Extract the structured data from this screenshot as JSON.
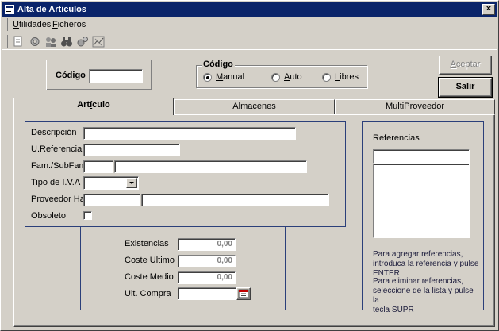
{
  "window": {
    "title": "Alta de Articulos",
    "close_glyph": "×"
  },
  "menu": {
    "items": [
      {
        "label": "Utilidades",
        "accel": "U",
        "rest": "tilidades"
      },
      {
        "label": "Ficheros",
        "accel": "F",
        "rest": "icheros"
      }
    ]
  },
  "toolbar": {
    "icons": [
      "document-icon",
      "gear-icon",
      "people-icon",
      "binoculars-icon",
      "gears-icon",
      "chart-icon"
    ]
  },
  "codigo": {
    "label": "Código",
    "value": ""
  },
  "codigo_mode": {
    "title": "Código",
    "options": [
      {
        "label": "Manual",
        "accel": "M",
        "rest": "anual",
        "selected": true
      },
      {
        "label": "Auto",
        "accel": "A",
        "rest": "uto",
        "selected": false
      },
      {
        "label": "Libres",
        "accel": "L",
        "rest": "ibres",
        "selected": false
      }
    ]
  },
  "buttons": {
    "aceptar": {
      "label": "Aceptar",
      "accel": "A",
      "rest": "ceptar",
      "enabled": false
    },
    "salir": {
      "label": "Salir",
      "accel": "S",
      "rest": "alir",
      "enabled": true
    }
  },
  "tabs": [
    {
      "label": "Artículo",
      "pre": "Art",
      "accel": "í",
      "rest": "culo",
      "active": true
    },
    {
      "label": "Almacenes",
      "pre": "Al",
      "accel": "m",
      "rest": "acenes",
      "active": false
    },
    {
      "label": "MultiProveedor",
      "pre": "Multi",
      "accel": "P",
      "rest": "roveedor",
      "active": false
    }
  ],
  "articulo": {
    "descripcion_label": "Descripción",
    "ureferencia_label": "U.Referencia",
    "famsubfam_label": "Fam./SubFam.",
    "tipo_iva_label": "Tipo de I.V.A",
    "proveedor_label": "Proveedor Hab.",
    "obsoleto_label": "Obsoleto",
    "descripcion": "",
    "ureferencia": "",
    "familia": "",
    "subfamilia": "",
    "tipo_iva": "",
    "proveedor_codigo": "",
    "proveedor_nombre": "",
    "obsoleto": false
  },
  "stock": {
    "existencias_label": "Existencias",
    "coste_ultimo_label": "Coste Ultimo",
    "coste_medio_label": "Coste Medio",
    "ult_compra_label": "Ult. Compra",
    "existencias": "0,00",
    "coste_ultimo": "0,00",
    "coste_medio": "0,00",
    "ult_compra": ""
  },
  "referencias": {
    "title": "Referencias",
    "input_value": "",
    "help_add": [
      "Para agregar referencias,",
      "introduca la referencia y pulse",
      "ENTER"
    ],
    "help_remove": [
      "Para eliminar referencias,",
      "seleccione de la lista y pulse la",
      "tecla SUPR"
    ]
  },
  "colors": {
    "title_bar": "#0a246a",
    "face": "#d4d0c8",
    "frame": "#2b3f7a"
  }
}
